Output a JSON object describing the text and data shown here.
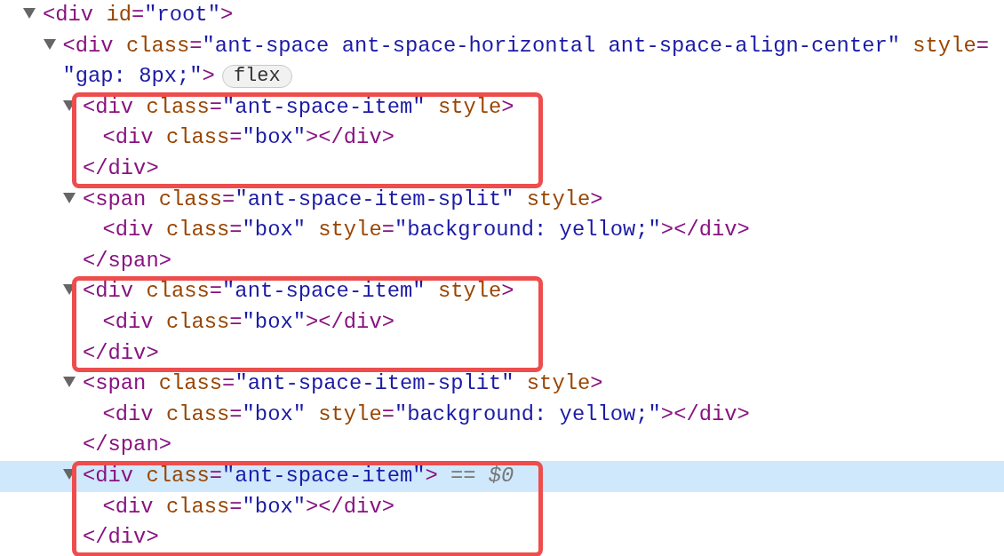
{
  "nodes": [
    {
      "markup": "<div id=\"root\">",
      "expanded": true,
      "selected": false,
      "children": [
        {
          "markup": "<div class=\"ant-space ant-space-horizontal ant-space-align-center\" style=",
          "continuation": "\"gap: 8px;\">",
          "badge": "flex",
          "expanded": true,
          "selected": false,
          "children": [
            {
              "markup": "<div class=\"ant-space-item\" style>",
              "expanded": true,
              "selected": false,
              "highlighted": true,
              "children": [
                {
                  "markup": "<div class=\"box\"></div>",
                  "selected": false
                }
              ],
              "closing": "</div>"
            },
            {
              "markup": "<span class=\"ant-space-item-split\" style>",
              "expanded": true,
              "selected": false,
              "children": [
                {
                  "markup": "<div class=\"box\" style=\"background: yellow;\"></div>",
                  "selected": false
                }
              ],
              "closing": "</span>"
            },
            {
              "markup": "<div class=\"ant-space-item\" style>",
              "expanded": true,
              "selected": false,
              "highlighted": true,
              "children": [
                {
                  "markup": "<div class=\"box\"></div>",
                  "selected": false
                }
              ],
              "closing": "</div>"
            },
            {
              "markup": "<span class=\"ant-space-item-split\" style>",
              "expanded": true,
              "selected": false,
              "children": [
                {
                  "markup": "<div class=\"box\" style=\"background: yellow;\"></div>",
                  "selected": false
                }
              ],
              "closing": "</span>"
            },
            {
              "markup": "<div class=\"ant-space-item\">",
              "console_ref": "== $0",
              "expanded": true,
              "selected": true,
              "highlighted": true,
              "children": [
                {
                  "markup": "<div class=\"box\"></div>",
                  "selected": false
                }
              ],
              "closing": "</div>"
            }
          ]
        }
      ]
    }
  ]
}
